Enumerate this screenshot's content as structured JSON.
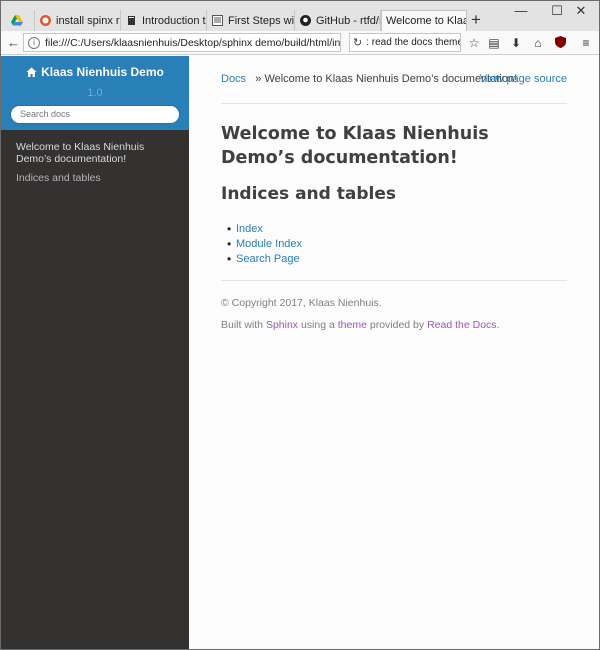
{
  "browser": {
    "tabs": [
      {
        "label": "",
        "favicon": "drive-icon",
        "active": false
      },
      {
        "label": "install spinx rst at...",
        "favicon": "duckduckgo-icon",
        "active": false
      },
      {
        "label": "Introduction to S...",
        "favicon": "book-icon",
        "active": false
      },
      {
        "label": "First Steps with S...",
        "favicon": "document-icon",
        "active": false
      },
      {
        "label": "GitHub - rtfd/sp...",
        "favicon": "github-icon",
        "active": false
      },
      {
        "label": "Welcome to Klaa...",
        "favicon": "",
        "active": true
      }
    ],
    "url": "file:///C:/Users/klaasnienhuis/Desktop/sphinx demo/build/html/index.",
    "search_value": ": read the docs theme"
  },
  "sidebar": {
    "project_name": "Klaas Nienhuis Demo",
    "version": "1.0",
    "search_placeholder": "Search docs",
    "menu": [
      "Welcome to Klaas Nienhuis Demo’s documentation!",
      "Indices and tables"
    ]
  },
  "breadcrumbs": {
    "root": "Docs",
    "separator": "»",
    "current": "Welcome to Klaas Nienhuis Demo’s documentation!",
    "view_source": "View page source"
  },
  "main": {
    "title": "Welcome to Klaas Nienhuis Demo’s documentation!",
    "section_title": "Indices and tables",
    "links": [
      "Index",
      "Module Index",
      "Search Page"
    ]
  },
  "footer": {
    "copyright": "© Copyright 2017, Klaas Nienhuis.",
    "built_prefix": "Built with",
    "sphinx": "Sphinx",
    "using": "using a",
    "theme": "theme",
    "provided": "provided by",
    "rtd": "Read the Docs",
    "end": "."
  },
  "colors": {
    "sidebar_top": "#2980b9",
    "sidebar_bg": "#343131",
    "link": "#2980b9",
    "footer_link": "#9b59b6"
  }
}
